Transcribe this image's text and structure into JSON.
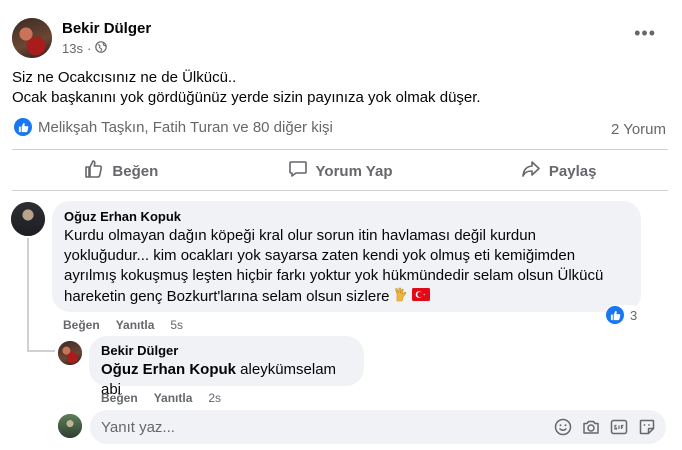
{
  "post": {
    "author": "Bekir Dülger",
    "time": "13s",
    "text_line1": "Siz ne Ocakcısınız ne de Ülkücü..",
    "text_line2": "Ocak başkanını yok gördüğünüz yerde sizin payınıza yok olmak düşer.",
    "reactions_text": "Melikşah Taşkın, Fatih Turan ve 80 diğer kişi",
    "comment_count": "2 Yorum"
  },
  "actions": {
    "like": "Beğen",
    "comment": "Yorum Yap",
    "share": "Paylaş"
  },
  "comment": {
    "author": "Oğuz Erhan Kopuk",
    "line1": "Kurdu olmayan dağın köpeği kral olur sorun itin havlaması değil kurdun",
    "line2": "yokluğudur... kim ocakları yok sayarsa zaten kendi yok olmuş eti kemiğimden",
    "line3": "ayrılmış kokuşmuş leşten hiçbir farkı yoktur yok hükmündedir selam olsun Ülkücü",
    "line4": "hareketin genç Bozkurt'larına selam olsun sizlere",
    "like_label": "Beğen",
    "reply_label": "Yanıtla",
    "time": "5s",
    "reaction_count": "3"
  },
  "reply": {
    "author": "Bekir Dülger",
    "mention": "Oğuz Erhan Kopuk",
    "text": "aleykümselam abi",
    "like_label": "Beğen",
    "reply_label": "Yanıtla",
    "time": "2s"
  },
  "input": {
    "placeholder": "Yanıt yaz..."
  },
  "colors": {
    "accent": "#1877f2",
    "bubble": "#f0f2f5",
    "secondary_text": "#65676b"
  }
}
